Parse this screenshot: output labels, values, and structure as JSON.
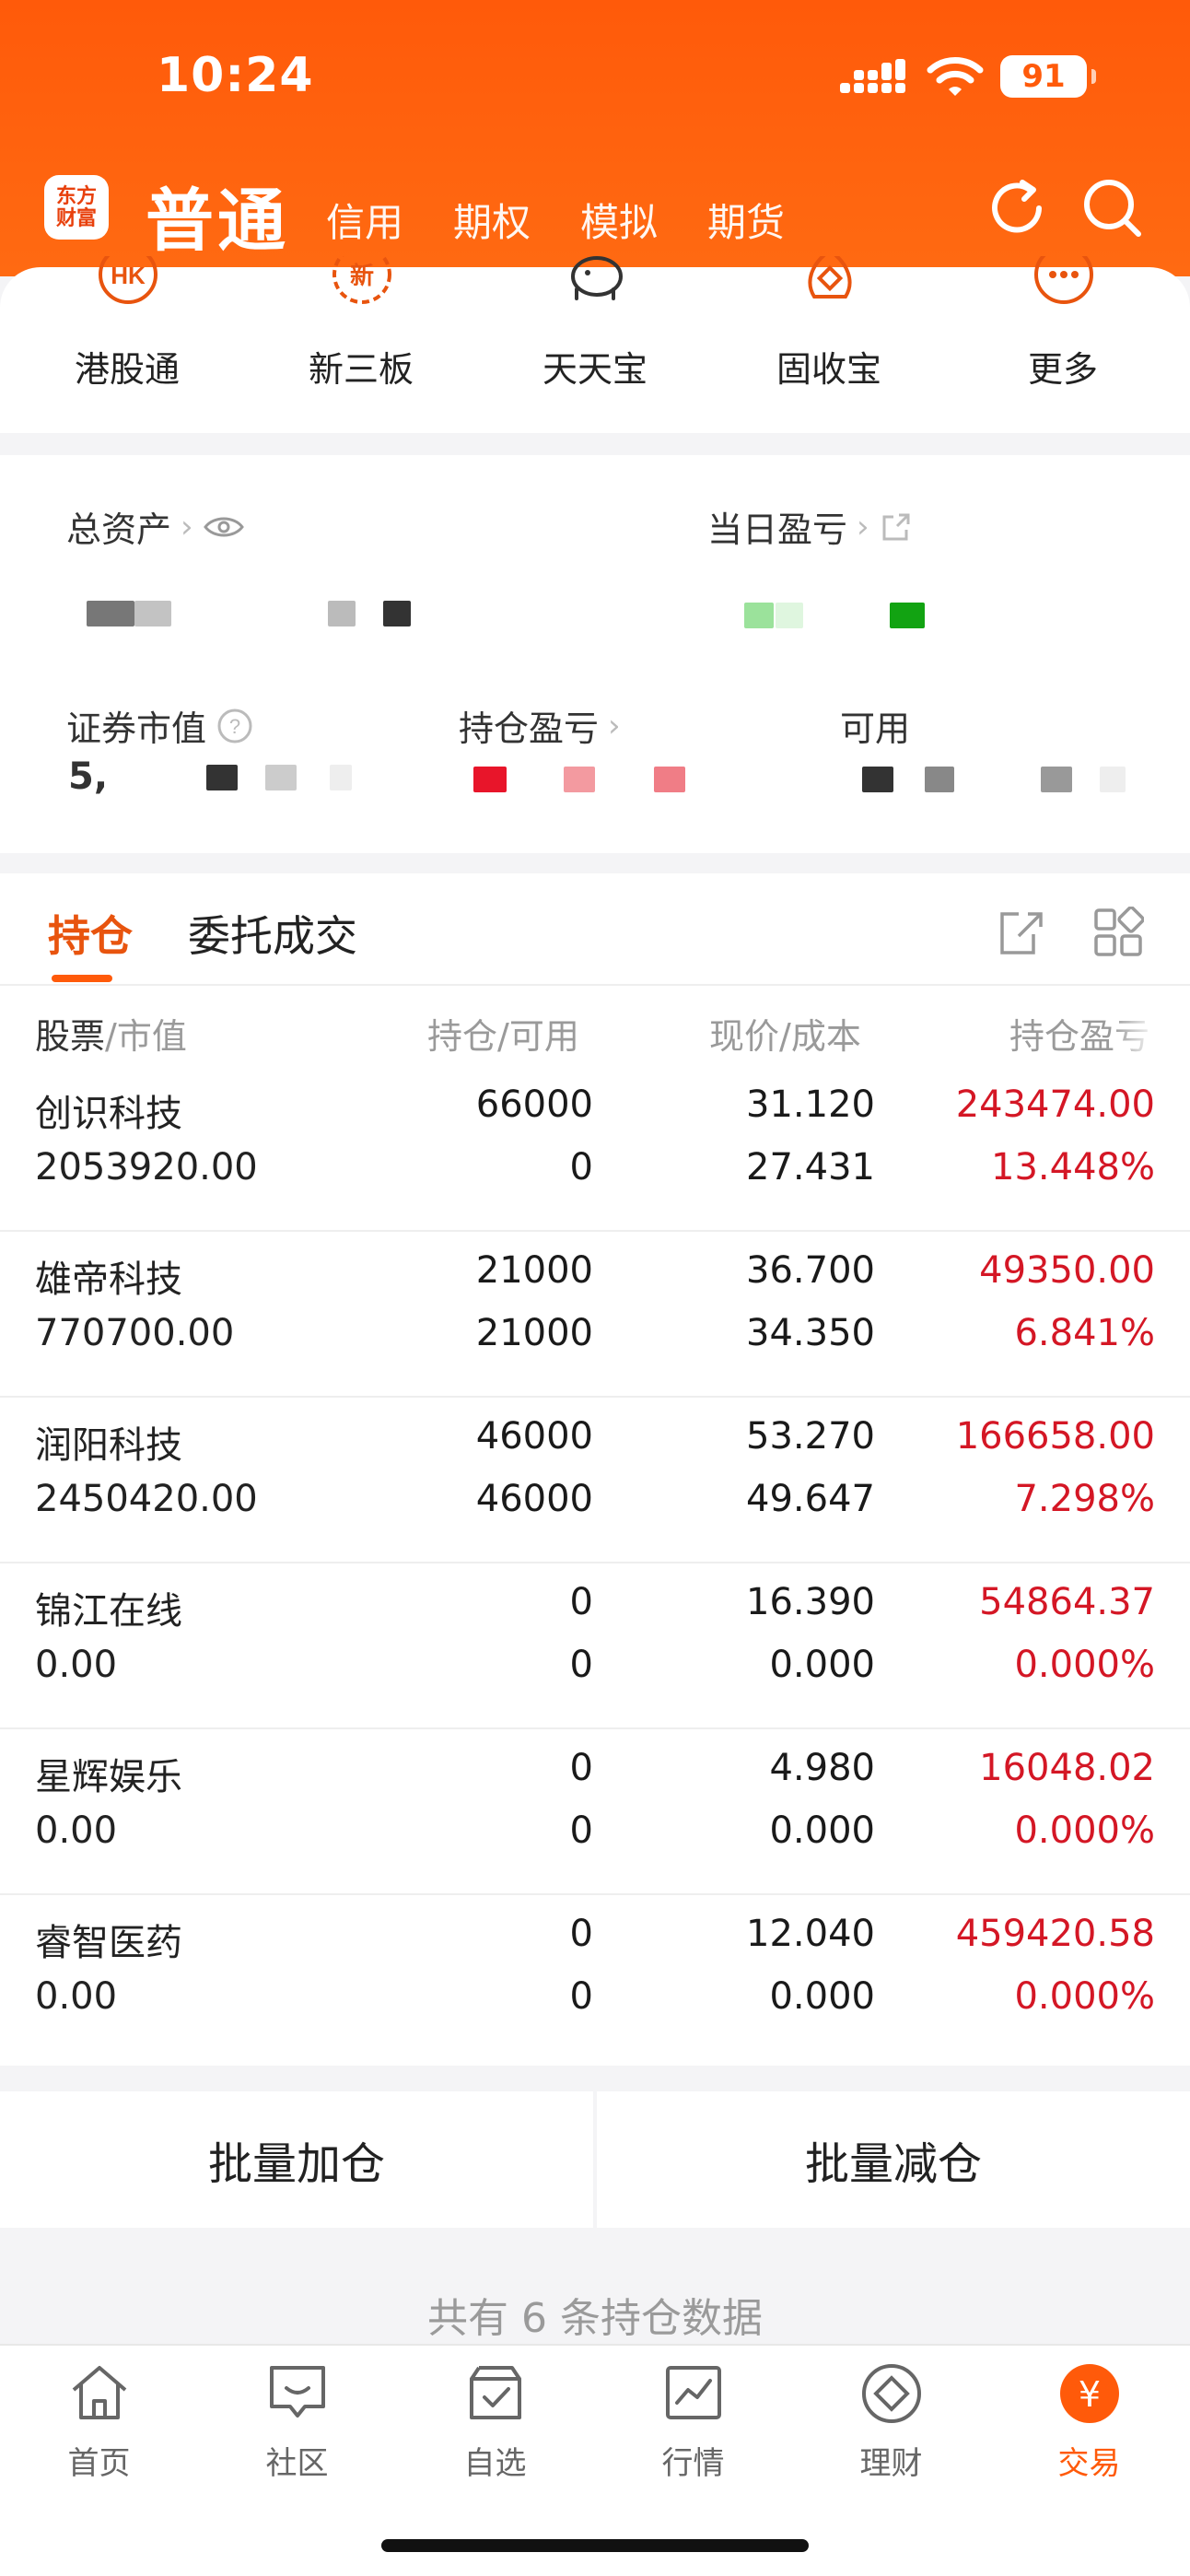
{
  "status": {
    "time": "10:24",
    "battery": "91"
  },
  "header": {
    "logo_line1": "东方",
    "logo_line2": "财富",
    "account_type": "普通",
    "tabs": [
      "信用",
      "期权",
      "模拟",
      "期货"
    ],
    "icons": [
      "refresh-icon",
      "search-icon"
    ]
  },
  "shortcuts": [
    {
      "label": "港股通",
      "icon": "hk-icon",
      "glyph": "HK"
    },
    {
      "label": "新三板",
      "icon": "new-board-icon",
      "glyph": "新"
    },
    {
      "label": "天天宝",
      "icon": "piggy-bank-icon",
      "glyph": ""
    },
    {
      "label": "固收宝",
      "icon": "fixed-income-icon",
      "glyph": ""
    },
    {
      "label": "更多",
      "icon": "more-icon",
      "glyph": "···"
    }
  ],
  "assets": {
    "total_label": "总资产",
    "daily_pl_label": "当日盈亏",
    "market_value_label": "证券市值",
    "position_pl_label": "持仓盈亏",
    "available_label": "可用",
    "market_value_prefix": "5,"
  },
  "positions": {
    "tabs": [
      "持仓",
      "委托成交"
    ],
    "headers": {
      "stock": "股票",
      "market_value": "/市值",
      "hold": "持仓",
      "avail": "/可用",
      "price": "现价",
      "cost": "/成本",
      "pl": "持仓盈亏"
    },
    "rows": [
      {
        "name": "创识科技",
        "value": "2053920.00",
        "hold": "66000",
        "avail": "0",
        "price": "31.120",
        "cost": "27.431",
        "pl": "243474.00",
        "pl_pct": "13.448%"
      },
      {
        "name": "雄帝科技",
        "value": "770700.00",
        "hold": "21000",
        "avail": "21000",
        "price": "36.700",
        "cost": "34.350",
        "pl": "49350.00",
        "pl_pct": "6.841%"
      },
      {
        "name": "润阳科技",
        "value": "2450420.00",
        "hold": "46000",
        "avail": "46000",
        "price": "53.270",
        "cost": "49.647",
        "pl": "166658.00",
        "pl_pct": "7.298%"
      },
      {
        "name": "锦江在线",
        "value": "0.00",
        "hold": "0",
        "avail": "0",
        "price": "16.390",
        "cost": "0.000",
        "pl": "54864.37",
        "pl_pct": "0.000%"
      },
      {
        "name": "星辉娱乐",
        "value": "0.00",
        "hold": "0",
        "avail": "0",
        "price": "4.980",
        "cost": "0.000",
        "pl": "16048.02",
        "pl_pct": "0.000%"
      },
      {
        "name": "睿智医药",
        "value": "0.00",
        "hold": "0",
        "avail": "0",
        "price": "12.040",
        "cost": "0.000",
        "pl": "459420.58",
        "pl_pct": "0.000%"
      }
    ]
  },
  "batch": {
    "add": "批量加仓",
    "reduce": "批量减仓"
  },
  "count_text": "共有 6 条持仓数据",
  "tabbar": [
    {
      "label": "首页",
      "icon": "home-icon"
    },
    {
      "label": "社区",
      "icon": "community-icon"
    },
    {
      "label": "自选",
      "icon": "watchlist-icon"
    },
    {
      "label": "行情",
      "icon": "market-icon"
    },
    {
      "label": "理财",
      "icon": "wealth-icon"
    },
    {
      "label": "交易",
      "icon": "trade-icon",
      "glyph": "¥"
    }
  ],
  "colors": {
    "accent": "#ff5a0a",
    "profit": "#d41725",
    "text": "#222222",
    "muted": "#9a9a9a"
  }
}
